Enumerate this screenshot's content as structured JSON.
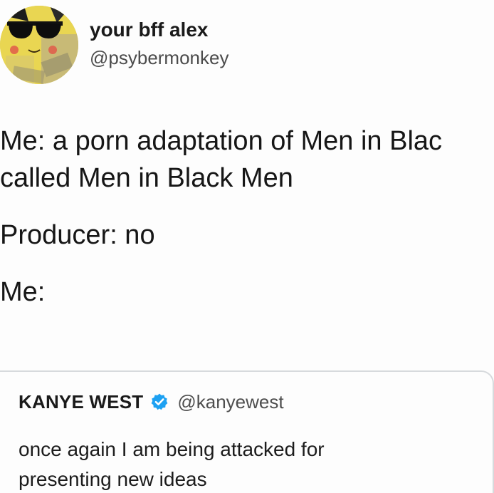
{
  "tweet": {
    "author": {
      "display_name": "your bff alex",
      "handle": "@psybermonkey",
      "avatar_icon": "pikachu-sunglasses-avatar"
    },
    "body": {
      "lines": [
        "Me: a porn adaptation of Men in Blac",
        "called Men in Black Men",
        "Producer: no",
        "Me:"
      ]
    }
  },
  "quoted_tweet": {
    "display_name": "KANYE WEST",
    "handle": "@kanyewest",
    "verified_icon": "verified-badge-icon",
    "verified_color": "#1da1f2",
    "text_lines": [
      "once again I am being attacked for",
      "presenting new ideas"
    ]
  }
}
